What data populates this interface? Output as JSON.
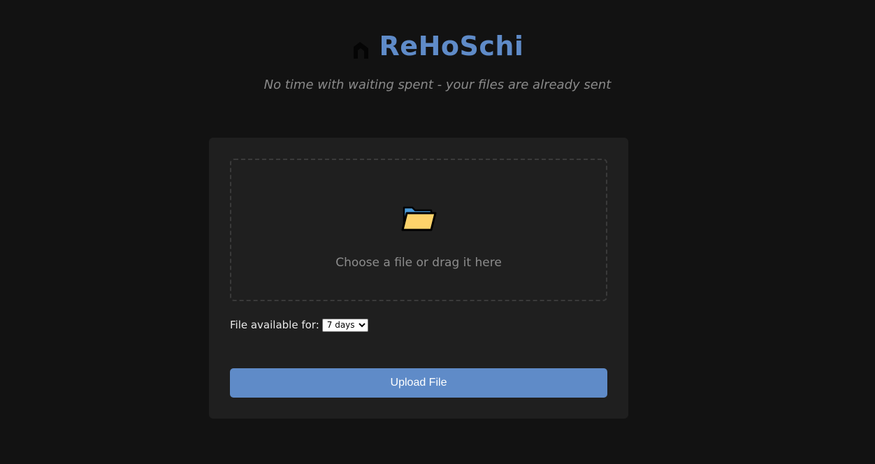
{
  "header": {
    "title": "ReHoSchi",
    "tagline": "No time with waiting spent - your files are already sent",
    "logo_icon": "rehoschi-logo-icon"
  },
  "upload": {
    "dropzone_icon": "folder-icon",
    "dropzone_text": "Choose a file or drag it here",
    "availability_label": "File available for:",
    "availability_selected": "7 days",
    "button_label": "Upload File"
  },
  "colors": {
    "background": "#121212",
    "card": "#1f1f1f",
    "accent": "#5f8bc8",
    "muted_text": "#8a8a8a"
  }
}
